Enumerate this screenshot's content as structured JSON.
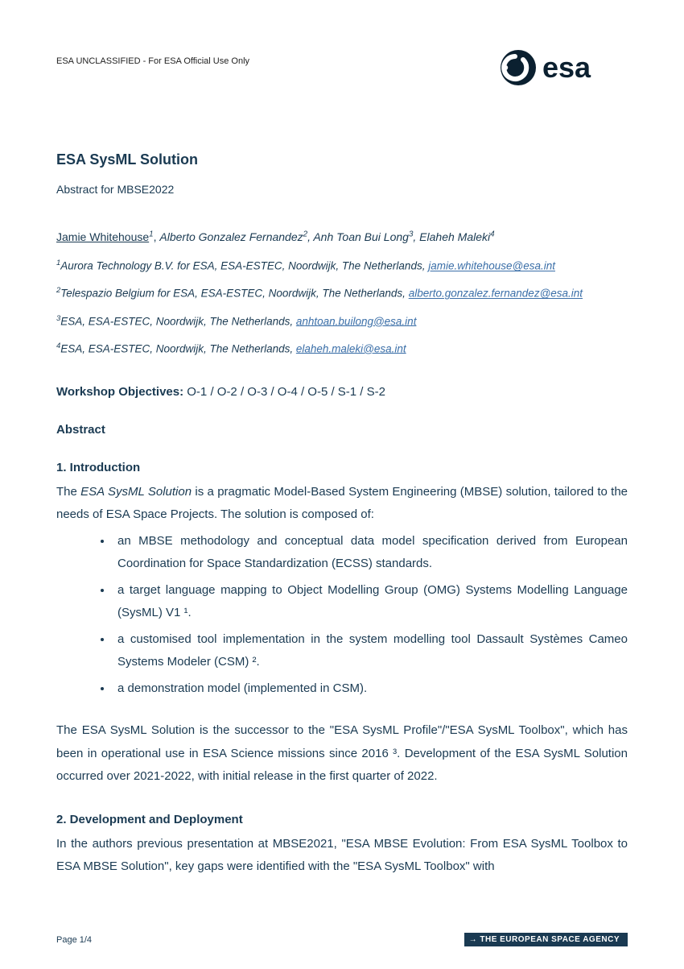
{
  "header": {
    "classification": "ESA UNCLASSIFIED - For ESA Official Use Only",
    "logo_text": "esa"
  },
  "title": "ESA SysML Solution",
  "subtitle": "Abstract for MBSE2022",
  "authors": {
    "lead": "Jamie Whitehouse",
    "lead_sup": "1",
    "others": [
      {
        "name": "Alberto Gonzalez Fernandez",
        "sup": "2"
      },
      {
        "name": "Anh Toan Bui Long",
        "sup": "3"
      },
      {
        "name": "Elaheh Maleki",
        "sup": "4"
      }
    ]
  },
  "affiliations": [
    {
      "sup": "1",
      "text": "Aurora Technology B.V. for ESA, ESA-ESTEC, Noordwijk, The Netherlands,",
      "email": "jamie.whitehouse@esa.int"
    },
    {
      "sup": "2",
      "text": "Telespazio Belgium for ESA, ESA-ESTEC, Noordwijk, The Netherlands,",
      "email": "alberto.gonzalez.fernandez@esa.int"
    },
    {
      "sup": "3",
      "text": "ESA, ESA-ESTEC, Noordwijk, The Netherlands,",
      "email": "anhtoan.builong@esa.int"
    },
    {
      "sup": "4",
      "text": "ESA, ESA-ESTEC, Noordwijk, The Netherlands,",
      "email": "elaheh.maleki@esa.int"
    }
  ],
  "objectives": {
    "label": "Workshop Objectives:",
    "value": "O-1 / O-2 / O-3 / O-4 / O-5 / S-1 / S-2"
  },
  "abstract_heading": "Abstract",
  "sections": {
    "intro": {
      "heading": "1. Introduction",
      "lead_pre": "The ",
      "lead_em": "ESA SysML Solution",
      "lead_post": " is a pragmatic Model-Based System Engineering (MBSE) solution, tailored to the needs of ESA Space Projects. The solution is composed of:",
      "bullets": [
        "an MBSE methodology and conceptual data model specification derived from European Coordination for Space Standardization (ECSS) standards.",
        "a target language mapping to Object Modelling Group (OMG) Systems Modelling Language (SysML) V1 ¹.",
        "a customised tool implementation in the system modelling tool Dassault Systèmes Cameo Systems Modeler (CSM) ².",
        "a demonstration model (implemented in CSM)."
      ],
      "tail": "The ESA SysML Solution is the successor to the \"ESA SysML Profile\"/\"ESA SysML Toolbox\", which has been in operational use in ESA Science missions since 2016 ³. Development of the ESA SysML Solution occurred over 2021-2022, with initial release in the first quarter of 2022."
    },
    "dev": {
      "heading": "2. Development and Deployment",
      "body": "In the authors previous presentation at MBSE2021, \"ESA MBSE Evolution: From ESA SysML Toolbox to ESA MBSE Solution\", key gaps were identified with the \"ESA SysML Toolbox\" with"
    }
  },
  "footer": {
    "page": "Page 1/4",
    "agency": "THE EUROPEAN SPACE AGENCY"
  }
}
